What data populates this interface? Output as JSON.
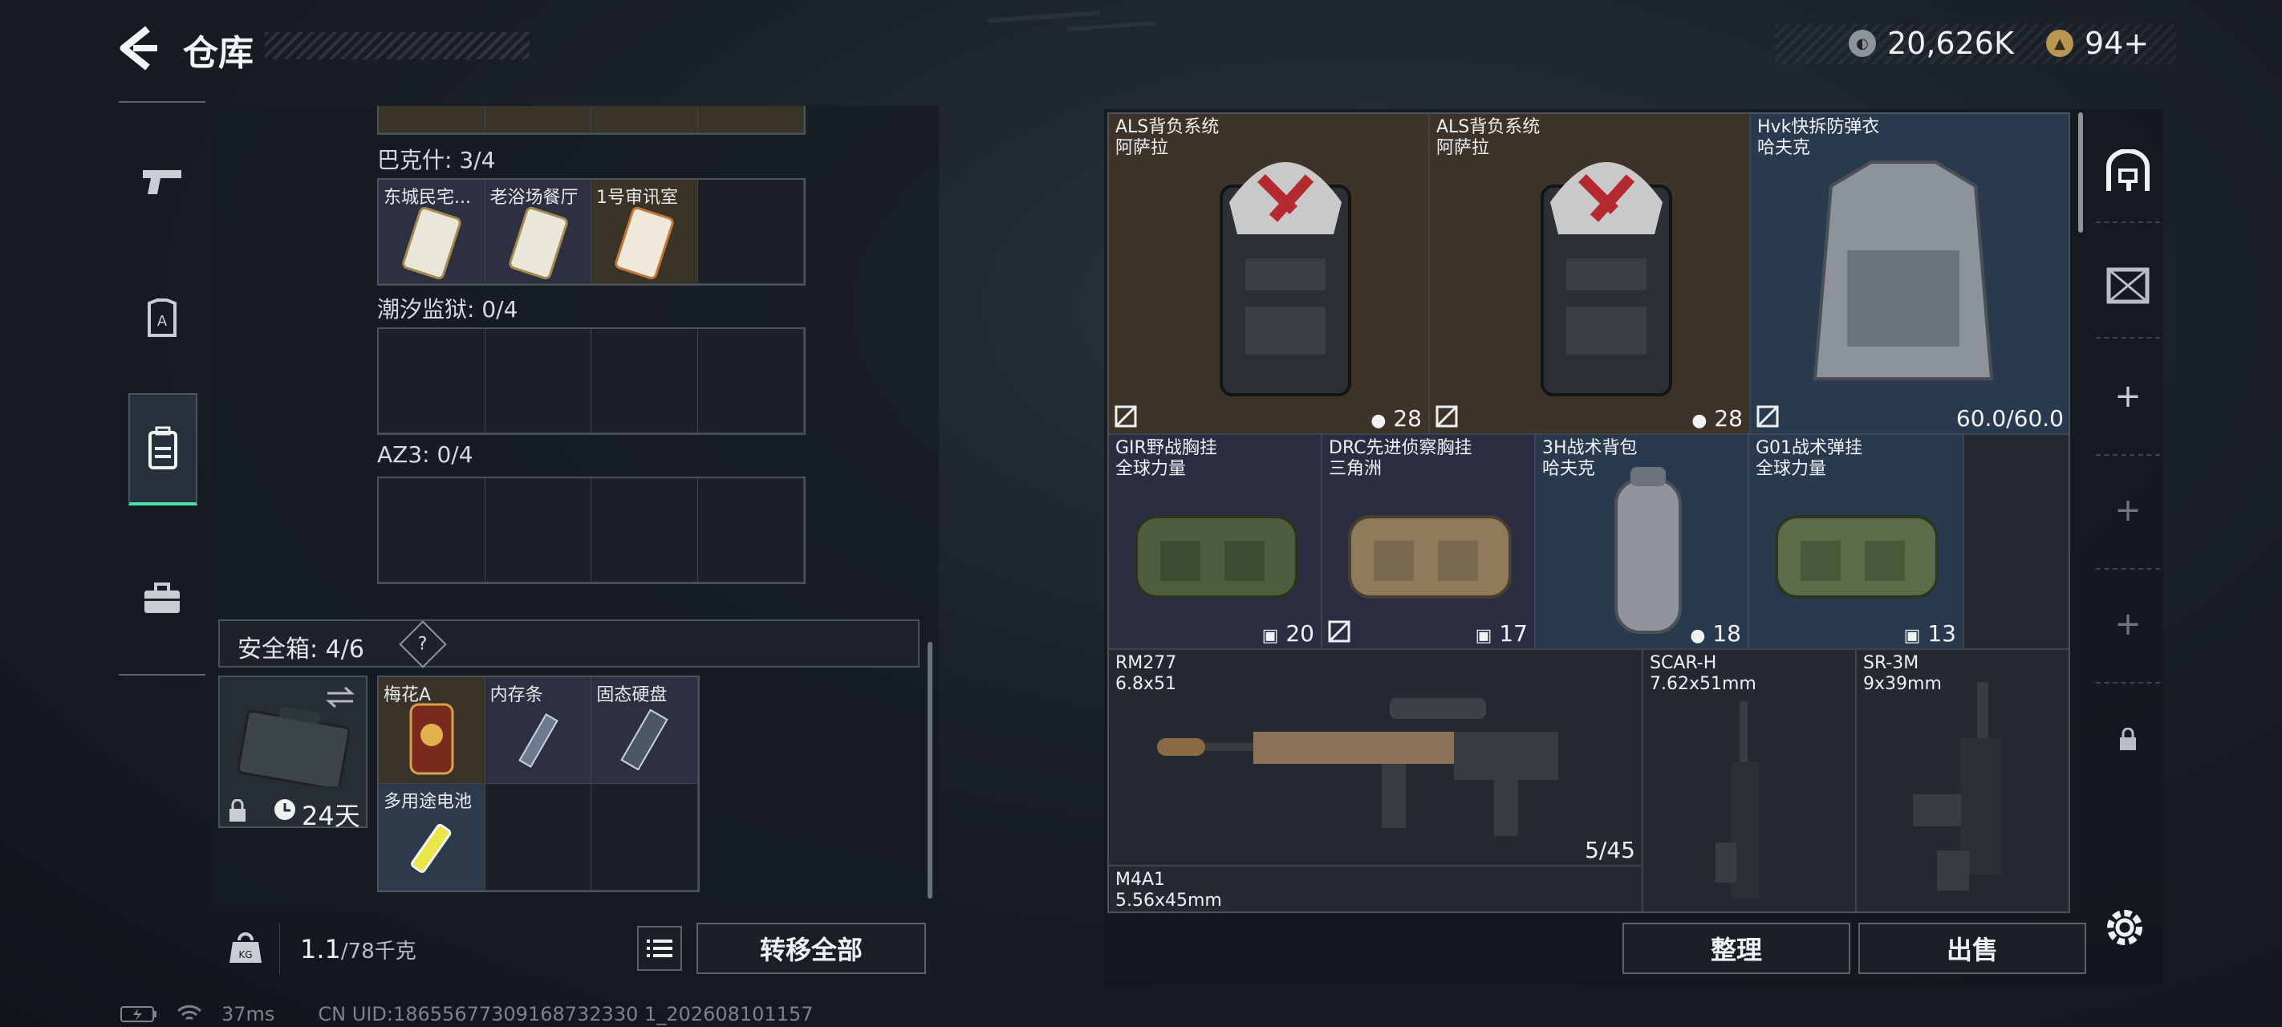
{
  "header": {
    "title": "仓库",
    "currency": [
      {
        "icon": "silver-coin-icon",
        "value": "20,626K"
      },
      {
        "icon": "gold-coin-icon",
        "value": "94+"
      }
    ]
  },
  "left_rail": {
    "items": [
      {
        "icon": "pistol-icon"
      },
      {
        "icon": "armor-plate-icon"
      },
      {
        "icon": "backpack-icon",
        "active": true
      },
      {
        "icon": "briefcase-icon"
      }
    ]
  },
  "keys_section": {
    "groups": [
      {
        "label": "巴克什: 3/4",
        "cells": [
          "东城民宅...",
          "老浴场餐厅",
          "1号审讯室",
          ""
        ]
      },
      {
        "label": "潮汐监狱: 0/4",
        "cells": [
          "",
          "",
          "",
          ""
        ]
      },
      {
        "label": "AZ3: 0/4",
        "cells": [
          "",
          "",
          "",
          ""
        ]
      }
    ]
  },
  "safe_box": {
    "header": "安全箱: 4/6",
    "help": "?",
    "duration": "24天",
    "cells": [
      "梅花A",
      "内存条",
      "固态硬盘",
      "多用途电池",
      "",
      ""
    ]
  },
  "bottom_left": {
    "weight_current": "1.1",
    "weight_max": "/78千克",
    "transfer_all": "转移全部"
  },
  "status": {
    "ping": "37ms",
    "uid": "CN UID:18655677309168732330 1_202608101157"
  },
  "stash_items": [
    {
      "name": "ALS背负系统\n阿萨拉",
      "badge": "28",
      "badge_icon": "weight-icon"
    },
    {
      "name": "ALS背负系统\n阿萨拉",
      "badge": "28",
      "badge_icon": "weight-icon"
    },
    {
      "name": "Hvk快拆防弹衣\n哈夫克",
      "badge": "60.0/60.0"
    },
    {
      "name": "GIR野战胸挂\n全球力量",
      "badge": "20",
      "badge_icon": "vest-icon"
    },
    {
      "name": "DRC先进侦察胸挂\n三角洲",
      "badge": "17",
      "badge_icon": "vest-icon"
    },
    {
      "name": "3H战术背包\n哈夫克",
      "badge": "18",
      "badge_icon": "weight-icon"
    },
    {
      "name": "G01战术弹挂\n全球力量",
      "badge": "13",
      "badge_icon": "vest-icon"
    },
    {
      "name": "RM277\n6.8x51",
      "badge": "5/45"
    },
    {
      "name": "SCAR-H\n7.62x51mm",
      "badge": ""
    },
    {
      "name": "SR-3M\n9x39mm",
      "badge": ""
    },
    {
      "name": "M4A1\n5.56x45mm",
      "badge": ""
    }
  ],
  "bottom_right": {
    "sort": "整理",
    "sell": "出售"
  },
  "right_rail": {
    "icons": [
      "safe-icon",
      "crate-icon",
      "plus-icon",
      "plus-icon",
      "plus-icon",
      "lock-icon"
    ]
  },
  "colors": {
    "accent": "#4be3a7",
    "gold_tier": "#3e3329",
    "blue_tier": "#2a3a4e",
    "purple_tier": "#2c2c42"
  }
}
